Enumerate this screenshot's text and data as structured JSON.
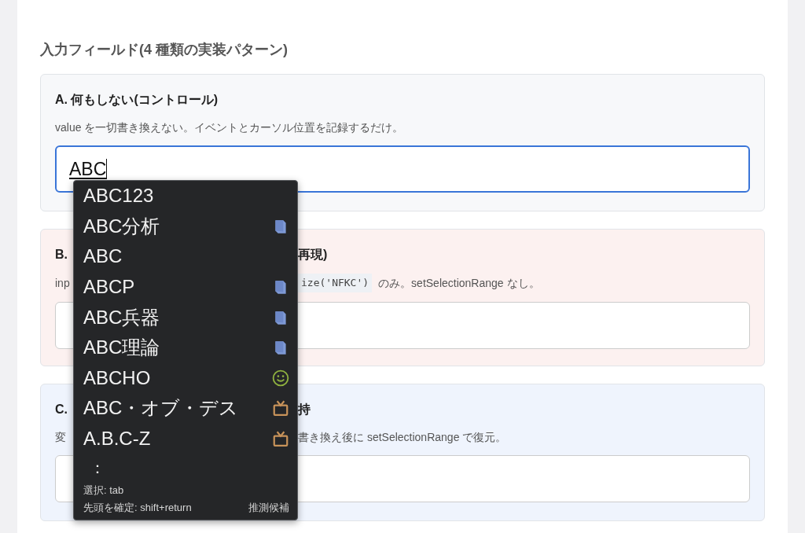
{
  "heading": "入力フィールド(4 種類の実装パターン)",
  "cards": [
    {
      "color": "#f7f8fa",
      "title": [
        "A. 何もしない(コントロール)"
      ],
      "description": [
        {
          "kind": "text",
          "text": "value を一切書き換えない。イベントとカーソル位置を記録するだけ。"
        }
      ],
      "input": {
        "value": "ABC",
        "focused": true
      }
    },
    {
      "color": "#fcf1f0",
      "title": [
        "B.",
        "再現)"
      ],
      "description": [
        {
          "kind": "text",
          "text": "inp"
        },
        {
          "kind": "code",
          "text": "ize('NFKC')"
        },
        {
          "kind": "text",
          "text": "のみ。setSelectionRange なし。"
        }
      ],
      "input": {
        "focused": false
      }
    },
    {
      "color": "#eff4fd",
      "title": [
        "C.",
        "持"
      ],
      "description": [
        {
          "kind": "text",
          "text": "変"
        },
        {
          "kind": "text",
          "text": "書き換え後に setSelectionRange で復元。"
        }
      ],
      "input": {
        "focused": false
      }
    }
  ],
  "suggestions": {
    "items": [
      {
        "text": "ABC123",
        "kind": "none"
      },
      {
        "text": "ABC分析",
        "kind": "book"
      },
      {
        "text": "ABC",
        "kind": "none"
      },
      {
        "text": "ABCP",
        "kind": "book"
      },
      {
        "text": "ABC兵器",
        "kind": "book"
      },
      {
        "text": "ABC理論",
        "kind": "book"
      },
      {
        "text": "ABCHO",
        "kind": "smiley"
      },
      {
        "text": "ABC・オブ・デス",
        "kind": "tv"
      },
      {
        "text": "A.B.C-Z",
        "kind": "tv"
      }
    ],
    "more": "：",
    "hint": "選択: tab",
    "confirm": "先頭を確定: shift+return",
    "source": "推測候補"
  }
}
